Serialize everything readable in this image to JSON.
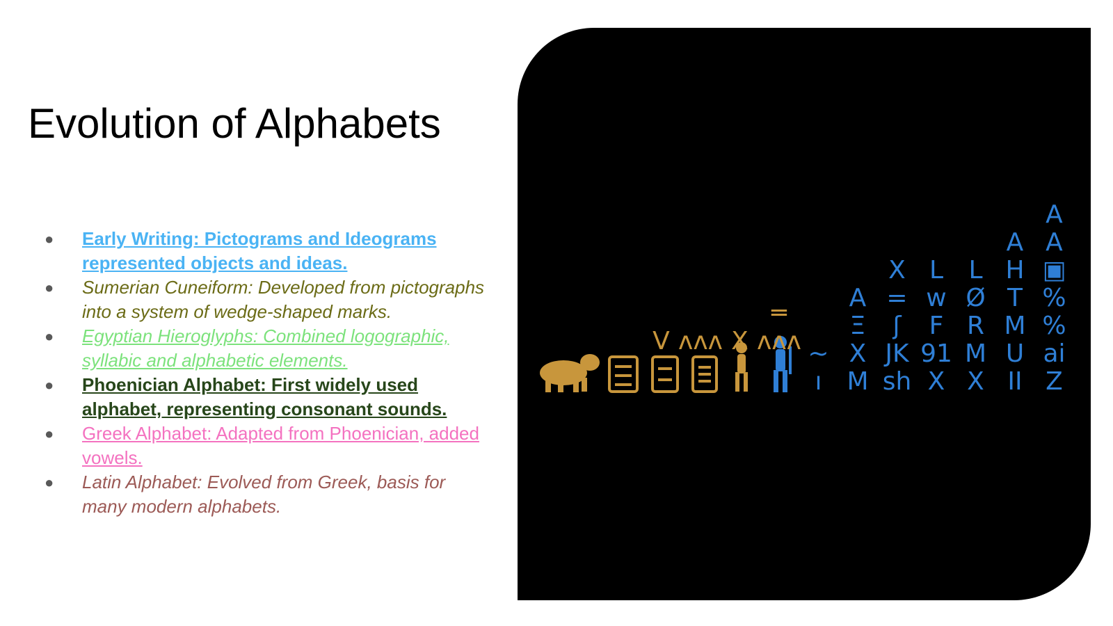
{
  "slide": {
    "title": "Evolution of Alphabets",
    "bullets": [
      {
        "text": "Early Writing: Pictograms and Ideograms represented objects and ideas.",
        "color": "#4ab3f4"
      },
      {
        "text": "Sumerian Cuneiform: Developed from pictographs into a system of wedge-shaped marks.",
        "color": "#6b6b16"
      },
      {
        "text": "Egyptian Hieroglyphs: Combined logographic, syllabic and alphabetic elements.",
        "color": "#7ce27c"
      },
      {
        "text": "Phoenician Alphabet: First widely used alphabet, representing consonant sounds.",
        "color": "#27461a"
      },
      {
        "text": "Greek Alphabet: Adapted from Phoenician, added vowels.",
        "color": "#f472c0"
      },
      {
        "text": "Latin Alphabet: Evolved from Greek, basis for many modern alphabets.",
        "color": "#9c5a56"
      }
    ],
    "bullet_glyph": "●"
  },
  "image": {
    "background": "#000000",
    "gold": "#c8963c",
    "blue": "#2f7fd6",
    "columns": [
      {
        "glyphs": []
      },
      {
        "glyphs": [
          "V"
        ]
      },
      {
        "glyphs": [
          "ʌʌʌ"
        ]
      },
      {
        "glyphs": [
          "X"
        ]
      },
      {
        "glyphs": [
          "═",
          "ʌʌʌ"
        ]
      },
      {
        "glyphs": [
          "~",
          "ı"
        ]
      },
      {
        "glyphs": [
          "A",
          "Ξ",
          "X",
          "M"
        ]
      },
      {
        "glyphs": [
          "X",
          "=",
          "ʃ",
          "JK",
          "sh"
        ]
      },
      {
        "glyphs": [
          "L",
          "w",
          "F",
          "91",
          "X"
        ]
      },
      {
        "glyphs": [
          "L",
          "Ø",
          "R",
          "M",
          "X"
        ]
      },
      {
        "glyphs": [
          "A",
          "H",
          "T",
          "M",
          "U",
          "II"
        ]
      },
      {
        "glyphs": [
          "A",
          "A",
          "▣",
          "%",
          "%",
          "ai",
          "Z"
        ]
      }
    ]
  }
}
